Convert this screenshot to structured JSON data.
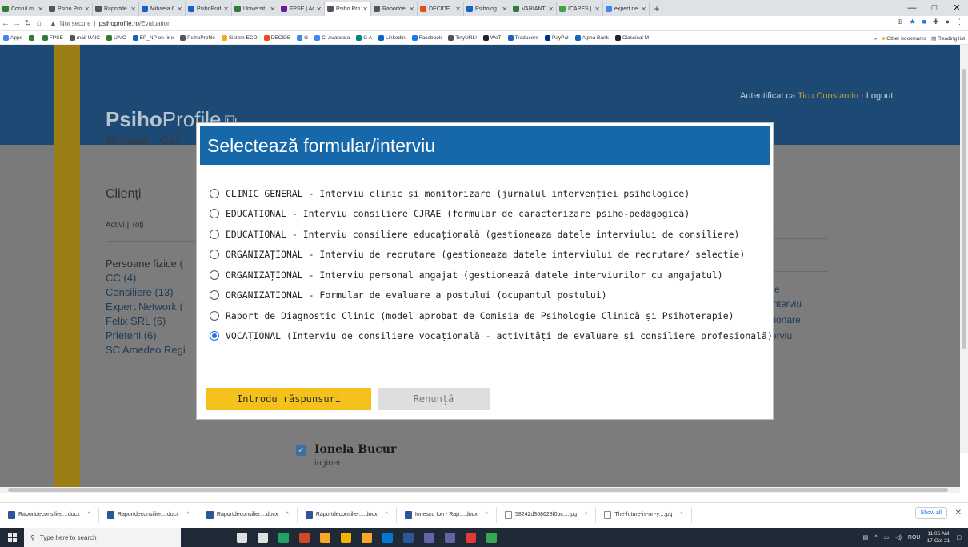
{
  "browser": {
    "tabs": [
      {
        "label": "Contul m",
        "color": "#2e7d32"
      },
      {
        "label": "Psiho Pro",
        "color": "#555555"
      },
      {
        "label": "Raportde",
        "color": "#555555"
      },
      {
        "label": "Mihaela C",
        "color": "#1565c0"
      },
      {
        "label": "PsihoProf",
        "color": "#1565c0"
      },
      {
        "label": "Universit",
        "color": "#2e7d32"
      },
      {
        "label": "FPSE | Ad",
        "color": "#6a1b9a"
      },
      {
        "label": "Psiho Pro",
        "color": "#555555",
        "active": true
      },
      {
        "label": "Raportde",
        "color": "#555555"
      },
      {
        "label": "DECIDE",
        "color": "#e64a19"
      },
      {
        "label": "Psiholog",
        "color": "#1565c0"
      },
      {
        "label": "VARIANT",
        "color": "#2e7d32"
      },
      {
        "label": "ICAPES | F",
        "color": "#43a047"
      },
      {
        "label": "expert ne",
        "color": "#4285f4"
      }
    ],
    "new_tab": "+",
    "window_controls": [
      "—",
      "□",
      "✕"
    ],
    "url": {
      "insecure_label": "Not secure",
      "host": "psihoprofile.ro",
      "path": "/Evaluation"
    },
    "bookmarks": [
      {
        "label": "Apps",
        "color": "#4285f4"
      },
      {
        "label": "",
        "color": "#2e7d32"
      },
      {
        "label": "FPSE",
        "color": "#2e7d32"
      },
      {
        "label": "mail UAIC",
        "color": "#555555"
      },
      {
        "label": "UAIC",
        "color": "#2e7d32"
      },
      {
        "label": "EP_NP on-line",
        "color": "#1565c0"
      },
      {
        "label": "PsihoProfile",
        "color": "#555555"
      },
      {
        "label": "Sistem ECO",
        "color": "#f9a825"
      },
      {
        "label": "DECIDE",
        "color": "#e64a19"
      },
      {
        "label": "G",
        "color": "#4285f4"
      },
      {
        "label": "C. Avansata",
        "color": "#4285f4"
      },
      {
        "label": "G A",
        "color": "#00897b"
      },
      {
        "label": "LinkedIn",
        "color": "#0a66c2"
      },
      {
        "label": "Facebook",
        "color": "#1877f2"
      },
      {
        "label": "TinyURL!",
        "color": "#555555"
      },
      {
        "label": "WeT",
        "color": "#222222"
      },
      {
        "label": "Traducere",
        "color": "#1565c0"
      },
      {
        "label": "PayPal",
        "color": "#003087"
      },
      {
        "label": "Alpha Bank",
        "color": "#1565c0"
      },
      {
        "label": "Classical M",
        "color": "#222222"
      }
    ],
    "bookmarks_overflow": "»",
    "other_bookmarks": "Other bookmarks",
    "reading_list": "Reading list"
  },
  "site": {
    "logo_bold": "Psiho",
    "logo_light": "Profile",
    "auth_prefix": "Autentificat ca ",
    "user_name": "Ticu Constantin",
    "auth_suffix": " · Logout",
    "nav": [
      "Sinteză",
      "Cal"
    ],
    "clients_heading": "Clienți",
    "filter": "Activi | Toți",
    "groups_prefix": "Persoane fizice (",
    "groups": [
      "CC (4)",
      "Consiliere (13)",
      "Expert Network (",
      "Felix SRL (6)",
      "Prieteni (6)",
      "SC Amedeo Regi"
    ],
    "right_frag_top": "ză",
    "right_frag": [
      "e",
      "/interviu",
      "stionare",
      "erviu"
    ],
    "client_name": "Ionela Bucur",
    "client_job": "inginer"
  },
  "modal": {
    "title": "Selectează formular/interviu",
    "options": [
      {
        "label": "CLINIC GENERAL - Interviu clinic și monitorizare (jurnalul intervenției psihologice)",
        "selected": false
      },
      {
        "label": "EDUCATIONAL - Interviu consiliere CJRAE (formular de caracterizare psiho-pedagogică)",
        "selected": false
      },
      {
        "label": "EDUCATIONAL - Interviu consiliere educațională (gestioneaza datele interviului de consiliere)",
        "selected": false
      },
      {
        "label": "ORGANIZAȚIONAL - Interviu de recrutare (gestioneaza datele interviului de recrutare/ selectie)",
        "selected": false
      },
      {
        "label": "ORGANIZAȚIONAL - Interviu personal angajat (gestionează datele interviurilor cu angajatul)",
        "selected": false
      },
      {
        "label": "ORGANIZATIONAL - Formular de evaluare a postului (ocupantul postului)",
        "selected": false
      },
      {
        "label": "Raport de Diagnostic Clinic (model aprobat de Comisia de Psihologie Clinică și Psihoterapie)",
        "selected": false
      },
      {
        "label": "VOCAȚIONAL (Interviu de consiliere vocațională - activități de evaluare și consiliere profesională)",
        "selected": true
      }
    ],
    "submit_label": "Introdu răspunsuri",
    "cancel_label": "Renunță"
  },
  "downloads": {
    "items": [
      {
        "label": "Raportdeconsilier....docx",
        "type": "docx"
      },
      {
        "label": "Raportdeconsilier....docx",
        "type": "docx"
      },
      {
        "label": "Raportdeconsilier....docx",
        "type": "docx"
      },
      {
        "label": "Raportdeconsilier....docx",
        "type": "docx"
      },
      {
        "label": "Ionescu Ion - Rap....docx",
        "type": "docx"
      },
      {
        "label": "58242d368628f0bc....jpg",
        "type": "jpg"
      },
      {
        "label": "The-future-is-on-y....jpg",
        "type": "jpg"
      }
    ],
    "show_all": "Show all"
  },
  "taskbar": {
    "search_placeholder": "Type here to search",
    "app_icons": [
      "#e0e0e0",
      "#e0e0e0",
      "#21a366",
      "#d24726",
      "#f9a825",
      "#f4b400",
      "#f9a825",
      "#0078d4",
      "#2b579a",
      "#6264a7",
      "#6264a7",
      "#e53935",
      "#34a853"
    ],
    "language": "ROU",
    "time": "11:05 AM",
    "date": "17-Oct-21"
  }
}
